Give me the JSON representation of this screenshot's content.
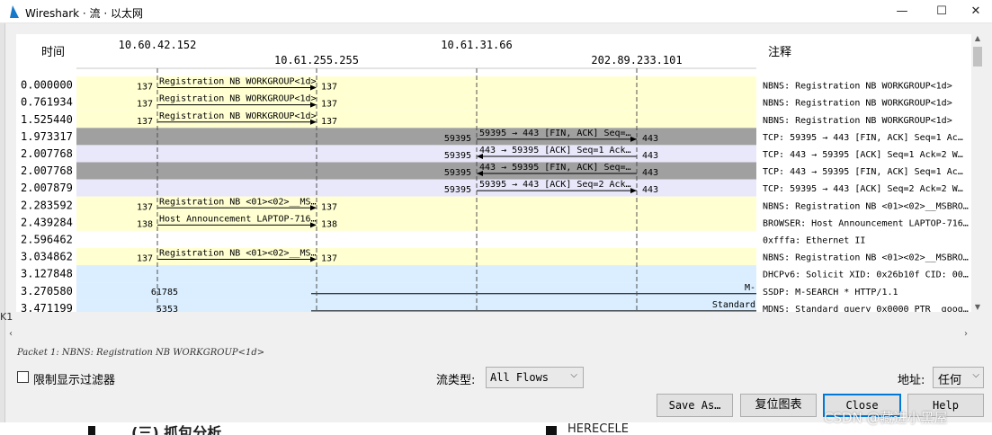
{
  "window": {
    "title": "Wireshark · 流 · 以太网",
    "min_glyph": "—",
    "max_glyph": "☐",
    "close_glyph": "✕",
    "icon": "wireshark-fin-icon",
    "icon_color": "#1679c9"
  },
  "flow": {
    "time_header": "时间",
    "comment_header": "注释",
    "hosts": [
      "10.60.42.152",
      "10.61.255.255",
      "10.61.31.66",
      "202.89.233.101"
    ],
    "colors": {
      "nbns_bg": "#ffffd2",
      "tcp_dark_bg": "#a0a0a0",
      "tcp_light_bg": "#e8e8fa",
      "udp_bg": "#daeeff",
      "white_bg": "#ffffff",
      "arrow": "#000000"
    },
    "rows": [
      {
        "time": "0.000000",
        "bg": "nbns",
        "src_port": "137",
        "dst_port": "137",
        "label": "Registration NB WORKGROUP<1d>",
        "comment": "NBNS: Registration NB WORKGROUP<1d>"
      },
      {
        "time": "0.761934",
        "bg": "nbns",
        "src_port": "137",
        "dst_port": "137",
        "label": "Registration NB WORKGROUP<1d>",
        "comment": "NBNS: Registration NB WORKGROUP<1d>"
      },
      {
        "time": "1.525440",
        "bg": "nbns",
        "src_port": "137",
        "dst_port": "137",
        "label": "Registration NB WORKGROUP<1d>",
        "comment": "NBNS: Registration NB WORKGROUP<1d>"
      },
      {
        "time": "1.973317",
        "bg": "tcp_dark",
        "src_port": "59395",
        "dst_port": "443",
        "label": "59395 → 443 [FIN, ACK] Seq=…",
        "comment": "TCP: 59395 → 443 [FIN, ACK] Seq=1 Ac…"
      },
      {
        "time": "2.007768",
        "bg": "tcp_light",
        "src_port": "59395",
        "dst_port": "443",
        "label": "443 → 59395 [ACK] Seq=1 Ack…",
        "comment": "TCP: 443 → 59395 [ACK] Seq=1 Ack=2 W…"
      },
      {
        "time": "2.007768",
        "bg": "tcp_dark",
        "src_port": "59395",
        "dst_port": "443",
        "label": "443 → 59395 [FIN, ACK] Seq=…",
        "comment": "TCP: 443 → 59395 [FIN, ACK] Seq=1 Ac…"
      },
      {
        "time": "2.007879",
        "bg": "tcp_light",
        "src_port": "59395",
        "dst_port": "443",
        "label": "59395 → 443 [ACK] Seq=2 Ack…",
        "comment": "TCP: 59395 → 443 [ACK] Seq=2 Ack=2 W…"
      },
      {
        "time": "2.283592",
        "bg": "nbns",
        "src_port": "137",
        "dst_port": "137",
        "label": "Registration NB <01><02>__MS…",
        "comment": "NBNS: Registration NB <01><02>__MSBRO…"
      },
      {
        "time": "2.439284",
        "bg": "nbns",
        "src_port": "138",
        "dst_port": "138",
        "label": "Host Announcement LAPTOP-716…",
        "comment": "BROWSER: Host Announcement LAPTOP-716…"
      },
      {
        "time": "2.596462",
        "bg": "white",
        "src_port": "",
        "dst_port": "",
        "label": "",
        "comment": "0xfffa: Ethernet II"
      },
      {
        "time": "3.034862",
        "bg": "nbns",
        "src_port": "137",
        "dst_port": "137",
        "label": "Registration NB <01><02>__MS…",
        "comment": "NBNS: Registration NB <01><02>__MSBRO…"
      },
      {
        "time": "3.127848",
        "bg": "udp",
        "src_port": "",
        "dst_port": "",
        "label": "",
        "comment": "DHCPv6: Solicit XID: 0x26b10f CID: 00…"
      },
      {
        "time": "3.270580",
        "bg": "udp",
        "src_port": "61785",
        "dst_port": "",
        "label": "M-",
        "comment": "SSDP: M-SEARCH * HTTP/1.1"
      },
      {
        "time": "3.471199",
        "bg": "udp",
        "src_port": "5353",
        "dst_port": "",
        "label": "Standard",
        "comment": "MDNS: Standard query 0x0000 PTR _goog…"
      }
    ]
  },
  "status": {
    "packet_info": "Packet 1: NBNS: Registration NB WORKGROUP<1d>"
  },
  "controls": {
    "limit_filter_label": "限制显示过滤器",
    "limit_filter_checked": false,
    "flow_type_label": "流类型:",
    "flow_type_value": "All Flows",
    "address_label": "地址:",
    "address_value": "任何",
    "chevron_glyph": "⌵"
  },
  "buttons": {
    "save_as": "Save As…",
    "reset": "复位图表",
    "close": "Close",
    "help": "Help"
  },
  "scroll": {
    "up_glyph": "▲",
    "down_glyph": "▼",
    "left_glyph": "‹",
    "right_glyph": "›"
  },
  "background_page": {
    "heading": "(三) 抓包分析",
    "word": "HERECELE",
    "strip_glyph": "K1"
  },
  "watermark": "CSDN @藏进小黑屋"
}
